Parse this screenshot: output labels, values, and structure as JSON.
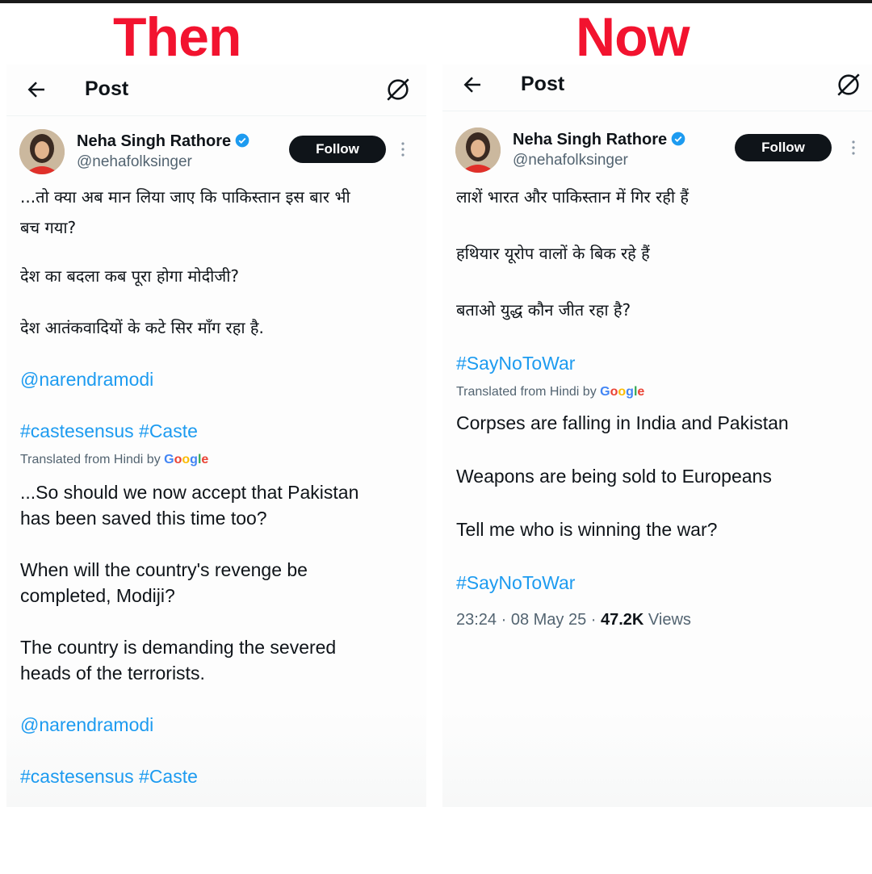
{
  "headings": {
    "then": "Then",
    "now": "Now"
  },
  "colors": {
    "heading_red": "#f2132f",
    "link_blue": "#1d9bf0",
    "follow_bg": "#0f1419",
    "verified": "#1d9bf0",
    "secondary_text": "#536471"
  },
  "left_post": {
    "header_title": "Post",
    "icons": {
      "back": "arrow-left-icon",
      "grok": "grok-slash-circle-icon",
      "verified": "verified-badge-icon",
      "more": "more-vertical-icon"
    },
    "author_name": "Neha Singh Rathore",
    "author_handle": "@nehafolksinger",
    "follow_label": "Follow",
    "hindi_line1": "...तो क्या अब मान लिया जाए कि पाकिस्तान इस बार भी",
    "hindi_line2": "बच गया?",
    "hindi_para2": "देश का बदला कब पूरा होगा मोदीजी?",
    "hindi_para3": "देश आतंकवादियों के कटे सिर माँग रहा है.",
    "mention": "@narendramodi",
    "hashtags": "#castesensus #Caste",
    "translated_prefix": "Translated from Hindi by",
    "google": "Google",
    "en_line1": "...So should we now accept that Pakistan",
    "en_line2": "has been saved this time too?",
    "en_line3": "When will the country's revenge be",
    "en_line4": "completed, Modiji?",
    "en_line5": "The country is demanding the severed",
    "en_line6": "heads of the terrorists.",
    "mention_2": "@narendramodi",
    "hashtags_2": "#castesensus #Caste"
  },
  "right_post": {
    "header_title": "Post",
    "author_name": "Neha Singh Rathore",
    "author_handle": "@nehafolksinger",
    "follow_label": "Follow",
    "hindi_para1": "लाशें भारत और पाकिस्तान में गिर रही हैं",
    "hindi_para2": "हथियार यूरोप वालों के बिक रहे हैं",
    "hindi_para3": "बताओ युद्ध कौन जीत रहा है?",
    "hashtag": "#SayNoToWar",
    "translated_prefix": "Translated from Hindi by",
    "google": "Google",
    "en_para1": "Corpses are falling in India and Pakistan",
    "en_para2": "Weapons are being sold to Europeans",
    "en_para3": "Tell me who is winning the war?",
    "hashtag_2": "#SayNoToWar",
    "timestamp": "23:24 · 08 May 25 · ",
    "views_count": "47.2K",
    "views_label": " Views"
  }
}
